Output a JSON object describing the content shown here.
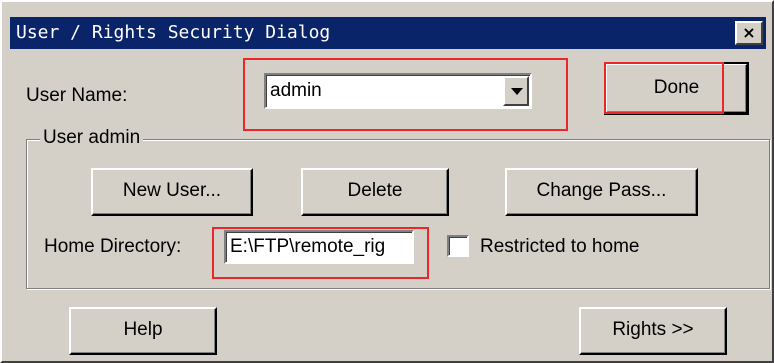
{
  "window": {
    "title": "User / Rights Security Dialog",
    "close_glyph": "×"
  },
  "user_name": {
    "label": "User Name:",
    "value": "admin"
  },
  "done_label": "Done",
  "user_admin": {
    "group_title": "User admin",
    "new_user_label": "New User...",
    "delete_label": "Delete",
    "change_pass_label": "Change Pass...",
    "home_dir_label": "Home Directory:",
    "home_dir_value": "E:\\FTP\\remote_rig",
    "restricted_label": "Restricted to home",
    "restricted_checked": false
  },
  "help_label": "Help",
  "rights_label": "Rights >>",
  "colors": {
    "titlebar": "#0a246a",
    "face": "#d4d0c8",
    "annotation": "#e8272b"
  },
  "icons": {
    "close": "close-icon",
    "dropdown": "chevron-down-icon"
  }
}
